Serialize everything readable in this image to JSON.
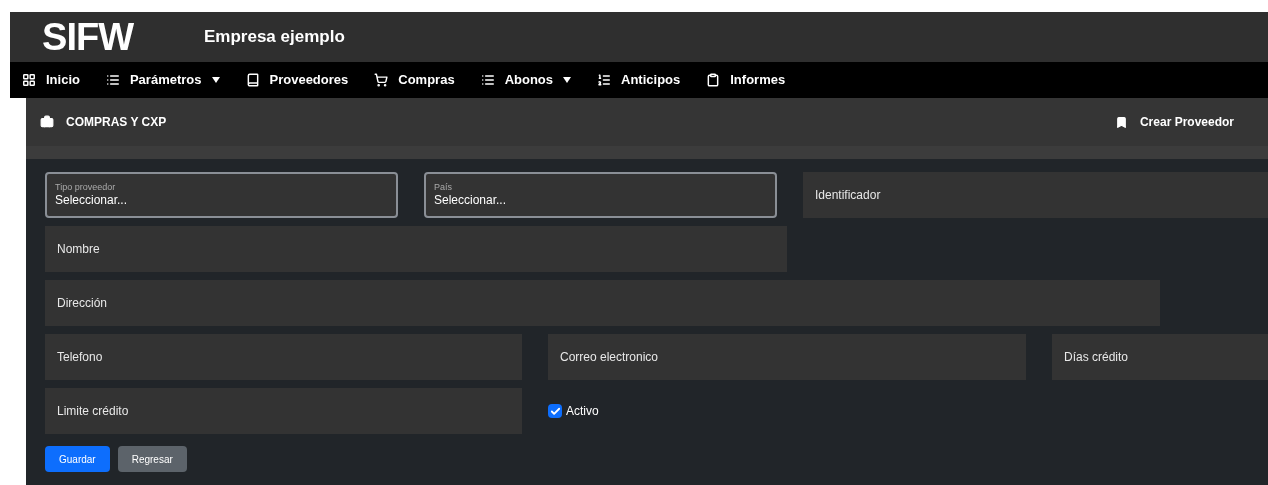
{
  "header": {
    "logo": "SIFW",
    "company": "Empresa ejemplo"
  },
  "nav": [
    {
      "label": "Inicio",
      "dropdown": false
    },
    {
      "label": "Parámetros",
      "dropdown": true
    },
    {
      "label": "Proveedores",
      "dropdown": false
    },
    {
      "label": "Compras",
      "dropdown": false
    },
    {
      "label": "Abonos",
      "dropdown": true
    },
    {
      "label": "Anticipos",
      "dropdown": false
    },
    {
      "label": "Informes",
      "dropdown": false
    }
  ],
  "section": {
    "title": "COMPRAS Y CXP",
    "action": "Crear Proveedor"
  },
  "form": {
    "rows": [
      [
        {
          "kind": "select",
          "label": "Tipo proveedor",
          "value": "Seleccionar..."
        },
        {
          "kind": "select",
          "label": "País",
          "value": "Seleccionar..."
        },
        {
          "kind": "input",
          "placeholder": "Identificador"
        }
      ],
      [
        {
          "kind": "input",
          "placeholder": "Nombre"
        }
      ],
      [
        {
          "kind": "input",
          "placeholder": "Dirección"
        }
      ],
      [
        {
          "kind": "input",
          "placeholder": "Telefono"
        },
        {
          "kind": "input",
          "placeholder": "Correo electronico"
        },
        {
          "kind": "input",
          "placeholder": "Días crédito"
        }
      ],
      [
        {
          "kind": "input",
          "placeholder": "Limite crédito"
        },
        {
          "kind": "checkbox",
          "label": "Activo",
          "checked": true
        }
      ]
    ],
    "buttons": [
      {
        "label": "Guardar",
        "kind": "primary"
      },
      {
        "label": "Regresar",
        "kind": "secondary"
      }
    ]
  }
}
